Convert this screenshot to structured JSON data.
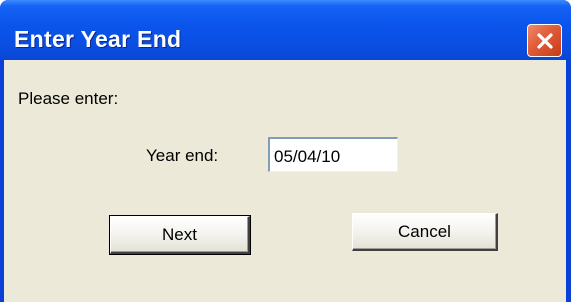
{
  "window": {
    "title": "Enter Year End",
    "close_icon": "close-icon"
  },
  "form": {
    "prompt": "Please enter:",
    "year_end_label": "Year end:",
    "year_end_value": "05/04/10"
  },
  "buttons": {
    "next_label": "Next",
    "cancel_label": "Cancel"
  },
  "colors": {
    "titlebar": "#0b55ec",
    "client_background": "#ece9d8",
    "close_button": "#e2603c"
  }
}
